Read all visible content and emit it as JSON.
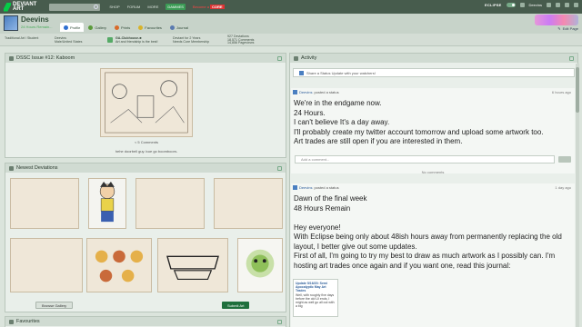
{
  "topbar": {
    "logo_line1": "DEVIANT",
    "logo_line2": "ART",
    "nav": [
      "SHOP",
      "FORUM",
      "MORE"
    ],
    "badge": "DAMMES",
    "core_label": "Become a",
    "core_badge": "CORE",
    "eclipse_label": "ECLIPSE",
    "username": "Deevins"
  },
  "profile": {
    "name": "Deevins",
    "subtitle": "24 Hours Remain...",
    "tabs": [
      {
        "label": "Profile",
        "color": "#2e6fd0"
      },
      {
        "label": "Gallery",
        "color": "#5a9a3a"
      },
      {
        "label": "Prints",
        "color": "#d86a2a"
      },
      {
        "label": "Favourites",
        "color": "#d8b32a"
      },
      {
        "label": "Journal",
        "color": "#5a7ab0"
      }
    ],
    "edit_page": "Edit Page"
  },
  "info": {
    "col1_line1": "Traditional Art / Student",
    "col2_line1": "Deevins",
    "col2_line2": "Male/United States",
    "group_title": "GA-Clubhouse-■",
    "group_sub": "Art and friendship is the best!",
    "col4_line1": "Deviant for 2 Years",
    "col4_line2": "Needs Core Membership",
    "stats_line1": "927 Deviations",
    "stats_line2": "18,571 Comments",
    "stats_line3": "14,856 Pageviews"
  },
  "dssc": {
    "title": "DSSC Issue #12: Kaboom",
    "comments": "< 5 Comments",
    "caption": "hehe doorbell guy /cue go boomboom-"
  },
  "newest": {
    "title": "Newest Deviations",
    "browse": "Browse Gallery",
    "submit": "Submit Art"
  },
  "favourites": {
    "title": "Favourites"
  },
  "activity": {
    "title": "Activity",
    "status_placeholder": "Share a Status Update with your watchers!",
    "comment_placeholder": "Add a comment...",
    "no_comments": "No comments",
    "posts": [
      {
        "author": "Deevins",
        "action": "posted a status",
        "time": "6 hours ago",
        "lines": [
          "We're in the endgame now.",
          "24 Hours.",
          "I can't believe It's a day away.",
          "I'll probably create my twitter account tomorrow and upload some artwork too.",
          "Art trades are still open if you are interested in them."
        ]
      },
      {
        "author": "Deevins",
        "action": "posted a status",
        "time": "1 day ago",
        "lines": [
          "Dawn of the final week",
          "48 Hours Remain",
          "",
          "Hey everyone!",
          "With Eclipse being only about 48ish hours away from permanently replacing the old layout, I better give out some updates.",
          "First of all, I'm going to try my best to draw as much artwork as I possibly can. I'm hosting art trades once again and if you want one, read this journal:"
        ]
      }
    ],
    "embed": {
      "title": "Update 5/16/20: Semi Apocalyptic May Art Trades",
      "body": "Well, with roughly five days before the old UI ends, I might as well go all out with a big"
    }
  }
}
